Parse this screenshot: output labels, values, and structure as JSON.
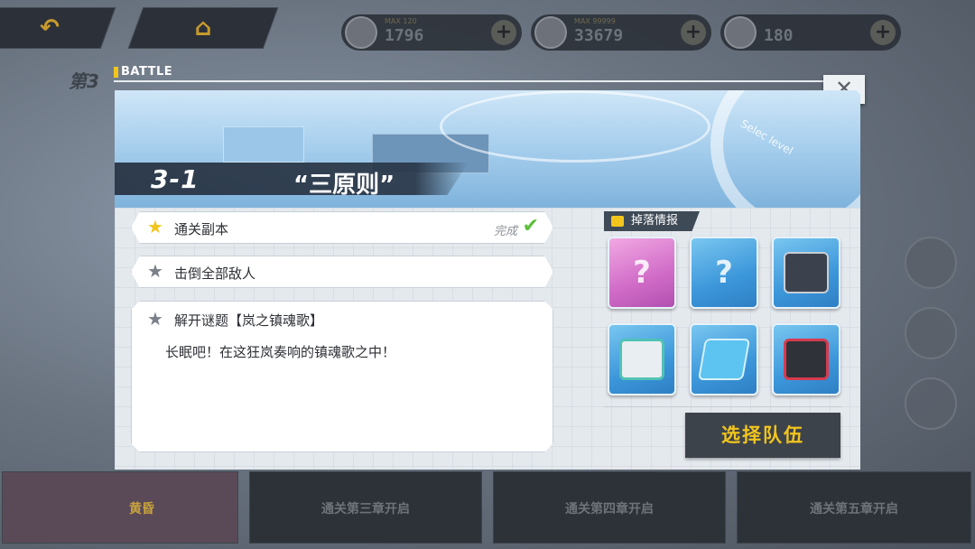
{
  "top_bar": {
    "back_icon": "back-arrow-icon",
    "home_icon": "home-icon",
    "resources": [
      {
        "icon": "stamina-icon",
        "max_text": "MAX 120",
        "value": "1796"
      },
      {
        "icon": "coin-icon",
        "max_text": "MAX 99999",
        "value": "33679"
      },
      {
        "icon": "crystal-icon",
        "max_text": "",
        "value": "180"
      }
    ],
    "plus_glyph": "+"
  },
  "background": {
    "chapter_title": "第3",
    "bottom_cards": [
      {
        "label": "黄昏"
      },
      {
        "label": "通关第三章开启"
      },
      {
        "label": "通关第四章开启"
      },
      {
        "label": "通关第五章开启"
      }
    ]
  },
  "dialog": {
    "header_label": "BATTLE",
    "close_glyph": "✕",
    "banner_text": "Selec level",
    "stage_number": "3-1",
    "stage_name": "“三原则”",
    "objectives": [
      {
        "label": "通关副本",
        "status": "完成",
        "check": "✔",
        "completed": true
      },
      {
        "label": "击倒全部敌人",
        "status": "",
        "completed": false
      }
    ],
    "puzzle": {
      "title": "解开谜题【岚之镇魂歌】",
      "description": "长眠吧！在这狂岚奏响的镇魂歌之中！"
    },
    "drops": {
      "label": "掉落情报",
      "items": [
        {
          "icon": "unknown-character-icon",
          "glyph": "?"
        },
        {
          "icon": "unknown-material-icon",
          "glyph": "?"
        },
        {
          "icon": "armor-chip-icon"
        },
        {
          "icon": "supply-box-icon"
        },
        {
          "icon": "data-chip-icon"
        },
        {
          "icon": "red-device-icon"
        }
      ]
    },
    "select_team_label": "选择队伍"
  },
  "colors": {
    "accent_yellow": "#f2c51d",
    "check_green": "#5cbf3a",
    "dark_panel": "#3d434b"
  }
}
